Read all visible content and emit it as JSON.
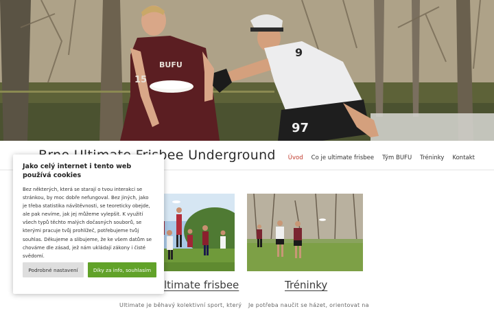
{
  "site": {
    "title": "Brno Ultimate Frisbee Underground"
  },
  "nav": {
    "items": [
      {
        "label": "Úvod",
        "active": true
      },
      {
        "label": "Co je ultimate frisbee",
        "active": false
      },
      {
        "label": "Tým BUFU",
        "active": false
      },
      {
        "label": "Tréninky",
        "active": false
      },
      {
        "label": "Kontakt",
        "active": false
      }
    ]
  },
  "cards": [
    {
      "title": "Ultimate frisbee",
      "text": "Ultimate je běhavý kolektivní sport, který"
    },
    {
      "title": "Tréninky",
      "text": "Je potřeba naučit se házet, orientovat na"
    }
  ],
  "cookie": {
    "heading": "Jako celý internet i tento web používá cookies",
    "body": "Bez některých, která se starají o tvou interakci se stránkou, by moc dobře nefungoval. Bez jiných, jako je třeba statistika návštěvnosti, se teoreticky obejde, ale pak nevíme, jak jej můžeme vylepšit. K využití všech typů těchto malých dočasných souborů, se kterými pracuje tvůj prohlížeč, potřebujeme tvůj souhlas. Děkujeme a slibujeme, že ke všem datům se chováme dle zásad, jež nám ukládají zákony i čisté svědomí.",
    "settings_label": "Podrobné nastavení",
    "accept_label": "Díky za info, souhlasím"
  },
  "hero": {
    "jersey_numbers": [
      "97"
    ]
  },
  "colors": {
    "accent": "#c0392b",
    "accept": "#61a229"
  }
}
